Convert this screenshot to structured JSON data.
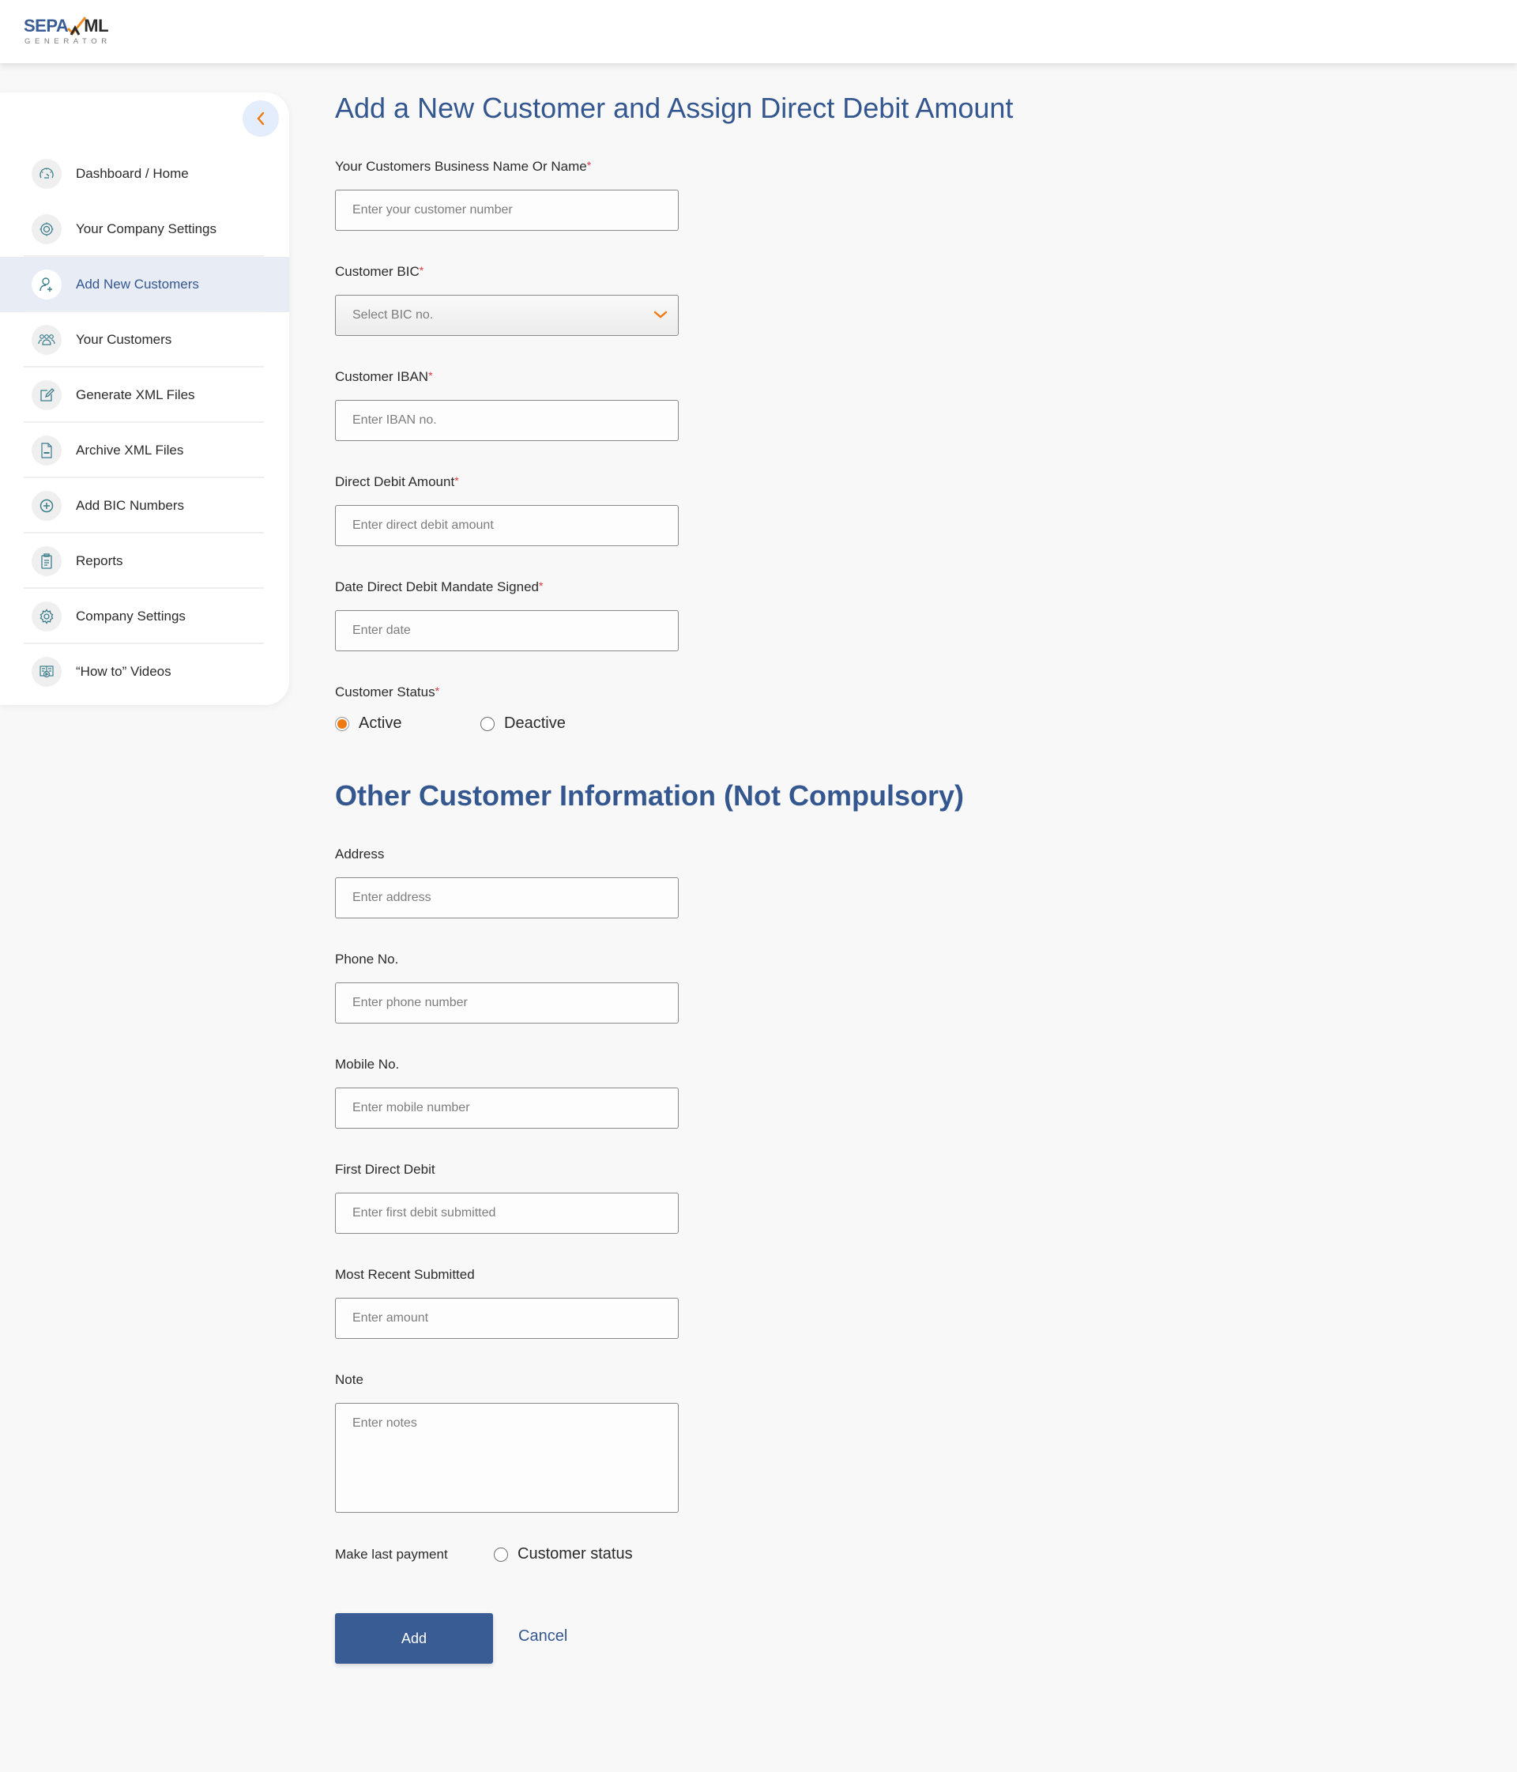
{
  "app": {
    "logo_text_primary": "SEPA",
    "logo_text_secondary": "ML",
    "logo_subtitle": "GENERATOR",
    "brand_color": "#34578f",
    "accent_color": "#f07a12"
  },
  "sidebar": {
    "toggle_icon": "chevron-left-icon",
    "items": [
      {
        "label": "Dashboard / Home",
        "icon": "speedometer-icon",
        "active": false
      },
      {
        "label": "Your Company Settings",
        "icon": "company-gear-icon",
        "active": false
      },
      {
        "label": "Add New Customers",
        "icon": "add-user-icon",
        "active": true
      },
      {
        "label": "Your Customers",
        "icon": "users-group-icon",
        "active": false
      },
      {
        "label": "Generate XML Files",
        "icon": "edit-document-icon",
        "active": false
      },
      {
        "label": "Archive XML Files",
        "icon": "xml-file-icon",
        "active": false
      },
      {
        "label": "Add BIC Numbers",
        "icon": "plus-circle-icon",
        "active": false
      },
      {
        "label": "Reports",
        "icon": "clipboard-icon",
        "active": false
      },
      {
        "label": "Company Settings",
        "icon": "gear-icon",
        "active": false
      },
      {
        "label": "“How to” Videos",
        "icon": "video-book-icon",
        "active": false
      }
    ]
  },
  "form": {
    "title": "Add a New Customer and Assign Direct Debit Amount",
    "required_mark": "*",
    "fields": {
      "name": {
        "label": "Your Customers Business Name Or Name",
        "placeholder": "Enter your customer number",
        "value": ""
      },
      "bic": {
        "label": "Customer BIC",
        "selected": "Select BIC no."
      },
      "iban": {
        "label": "Customer IBAN",
        "placeholder": "Enter IBAN no.",
        "value": ""
      },
      "amount": {
        "label": "Direct Debit Amount",
        "placeholder": "Enter direct debit amount",
        "value": ""
      },
      "mandate_date": {
        "label": "Date Direct Debit Mandate Signed",
        "placeholder": "Enter date",
        "value": ""
      }
    },
    "status": {
      "label": "Customer Status",
      "options": [
        {
          "label": "Active",
          "selected": true
        },
        {
          "label": "Deactive",
          "selected": false
        }
      ]
    },
    "other_title": "Other Customer Information (Not Compulsory)",
    "other_fields": {
      "address": {
        "label": "Address",
        "placeholder": "Enter address"
      },
      "phone": {
        "label": "Phone No.",
        "placeholder": "Enter phone number"
      },
      "mobile": {
        "label": "Mobile No.",
        "placeholder": "Enter mobile number"
      },
      "first_debit": {
        "label": "First Direct Debit",
        "placeholder": "Enter first debit submitted"
      },
      "recent": {
        "label": "Most Recent Submitted",
        "placeholder": "Enter amount"
      },
      "note": {
        "label": "Note",
        "placeholder": "Enter notes"
      }
    },
    "last_payment": {
      "label": "Make last payment",
      "option_label": "Customer status",
      "selected": false
    },
    "actions": {
      "add_label": "Add",
      "cancel_label": "Cancel"
    }
  }
}
